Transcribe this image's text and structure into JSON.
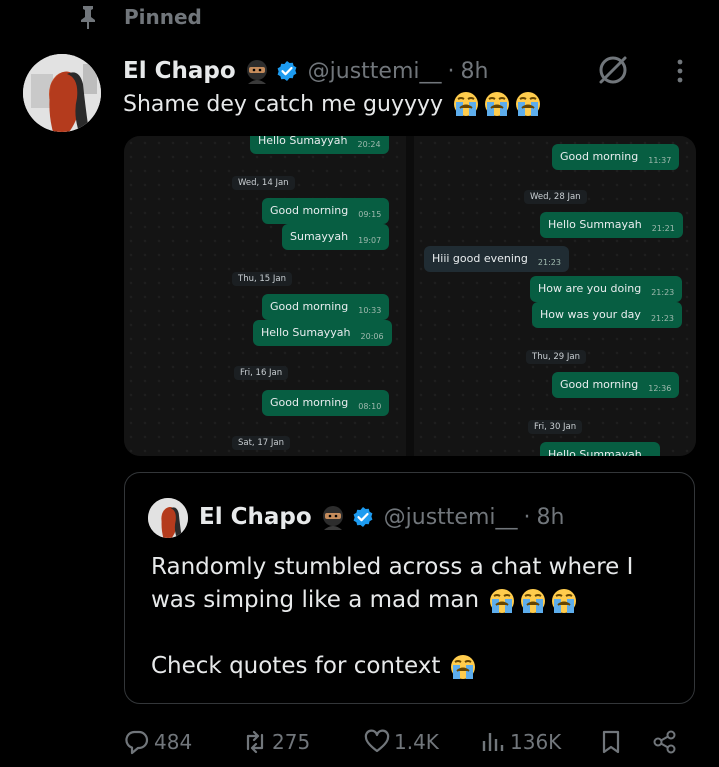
{
  "pinned": {
    "label": "Pinned"
  },
  "tweet": {
    "author_name": "El Chapo",
    "handle": "@justtemi__",
    "separator": "·",
    "time": "8h",
    "text": "Shame dey catch me guyyyy"
  },
  "media": {
    "left": {
      "top_bubble": {
        "text": "Hello Sumayyah",
        "time": "20:24"
      },
      "dates": [
        "Wed, 14 Jan",
        "Thu, 15 Jan",
        "Fri, 16 Jan",
        "Sat, 17 Jan"
      ],
      "bubbles": [
        {
          "text": "Good morning",
          "time": "09:15"
        },
        {
          "text": "Sumayyah",
          "time": "19:07"
        },
        {
          "text": "Good morning",
          "time": "10:33"
        },
        {
          "text": "Hello Sumayyah",
          "time": "20:06"
        },
        {
          "text": "Good morning",
          "time": "08:10"
        }
      ]
    },
    "right": {
      "dates": [
        "Wed, 28 Jan",
        "Thu, 29 Jan",
        "Fri, 30 Jan"
      ],
      "bubbles": [
        {
          "text": "Good morning",
          "time": "11:37"
        },
        {
          "text": "Hello Summayah",
          "time": "21:21"
        },
        {
          "text": "Hiii good evening",
          "time": "21:23"
        },
        {
          "text": "How are you doing",
          "time": "21:23"
        },
        {
          "text": "How was your day",
          "time": "21:23"
        },
        {
          "text": "Good morning",
          "time": "12:36"
        },
        {
          "text": "Hello Summayah",
          "time": ""
        }
      ]
    }
  },
  "quote": {
    "author_name": "El Chapo",
    "handle": "@justtemi__",
    "separator": "·",
    "time": "8h",
    "line1": "Randomly stumbled across a chat where I",
    "line2": "was simping like a mad man",
    "line3": "Check quotes for context"
  },
  "actions": {
    "replies": "484",
    "reposts": "275",
    "likes": "1.4K",
    "views": "136K"
  },
  "colors": {
    "verified": "#1d9bf0",
    "muted": "#71767b",
    "bubble_out": "#075e42"
  }
}
